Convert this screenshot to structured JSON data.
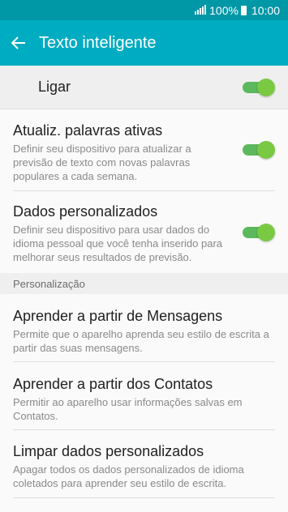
{
  "status_bar": {
    "battery": "100%",
    "time": "10:00"
  },
  "app_bar": {
    "title": "Texto inteligente"
  },
  "master": {
    "label": "Ligar",
    "on": true
  },
  "rows_toggle": [
    {
      "title": "Atualiz. palavras ativas",
      "subtitle": "Definir seu dispositivo para atualizar a previsão de texto com novas palavras populares a cada semana.",
      "on": true
    },
    {
      "title": "Dados personalizados",
      "subtitle": "Definir seu dispositivo para usar dados do idioma pessoal que você tenha inserido para melhorar seus resultados de previsão.",
      "on": true
    }
  ],
  "section": {
    "label": "Personalização"
  },
  "rows": [
    {
      "title": "Aprender a partir de Mensagens",
      "subtitle": "Permite que o aparelho aprenda seu estilo de escrita a partir das suas mensagens."
    },
    {
      "title": "Aprender a partir dos Contatos",
      "subtitle": "Permitir ao aparelho usar informações salvas em Contatos."
    },
    {
      "title": "Limpar dados personalizados",
      "subtitle": "Apagar todos os dados personalizados de idioma coletados para aprender seu estilo de escrita."
    }
  ],
  "colors": {
    "app_bar": "#00acc1",
    "status_bar": "#0097a7",
    "toggle_on": "#7ac943"
  }
}
